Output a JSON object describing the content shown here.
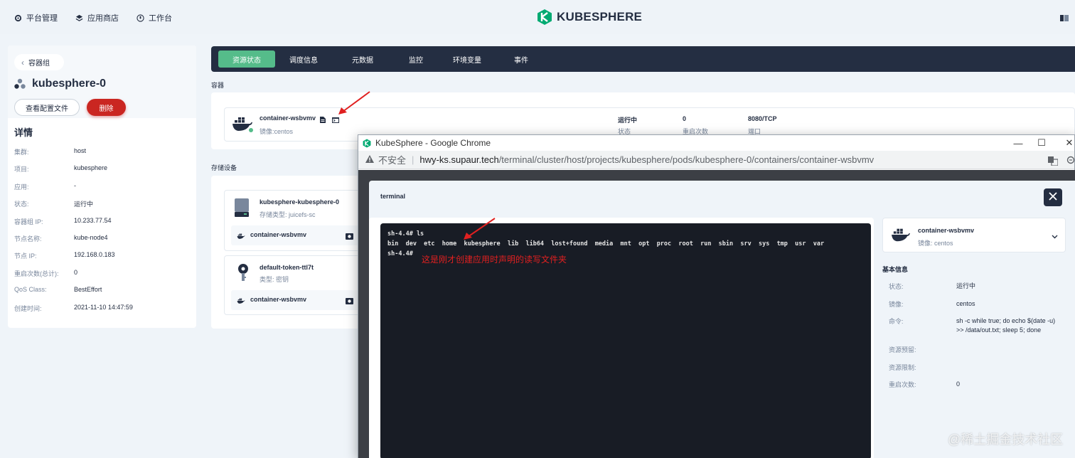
{
  "topnav": {
    "platform": "平台管理",
    "appstore": "应用商店",
    "workbench": "工作台",
    "brand": "KUBESPHERE"
  },
  "sidebar": {
    "back_label": "容器组",
    "pod_name": "kubesphere-0",
    "view_config_button": "查看配置文件",
    "delete_button": "删除",
    "details_title": "详情",
    "details": [
      {
        "key": "集群:",
        "value": "host"
      },
      {
        "key": "项目:",
        "value": "kubesphere"
      },
      {
        "key": "应用:",
        "value": "-"
      },
      {
        "key": "状态:",
        "value": "运行中"
      },
      {
        "key": "容器组 IP:",
        "value": "10.233.77.54"
      },
      {
        "key": "节点名称:",
        "value": "kube-node4"
      },
      {
        "key": "节点 IP:",
        "value": "192.168.0.183"
      },
      {
        "key": "重启次数(总计):",
        "value": "0"
      },
      {
        "key": "QoS Class:",
        "value": "BestEffort"
      },
      {
        "key": "创建时间:",
        "value": "2021-11-10 14:47:59"
      }
    ]
  },
  "tabs": [
    "资源状态",
    "调度信息",
    "元数据",
    "监控",
    "环境变量",
    "事件"
  ],
  "containers_section": {
    "label": "容器",
    "container": {
      "name": "container-wsbvmv",
      "image": "镜像:centos",
      "status_value": "运行中",
      "status_label": "状态",
      "restarts_value": "0",
      "restarts_label": "重启次数",
      "port_value": "8080/TCP",
      "port_label": "端口"
    }
  },
  "storage_section": {
    "label": "存储设备",
    "volumes": [
      {
        "name": "kubesphere-kubesphere-0",
        "type": "存储类型: juicefs-sc",
        "mount": "container-wsbvmv"
      },
      {
        "name": "default-token-ttl7t",
        "type": "类型: 密钥",
        "mount": "container-wsbvmv"
      }
    ]
  },
  "browser": {
    "title": "KubeSphere - Google Chrome",
    "insecure": "不安全",
    "url_host": "hwy-ks.supaur.tech",
    "url_path": "/terminal/cluster/host/projects/kubesphere/pods/kubesphere-0/containers/container-wsbvmv"
  },
  "terminal_modal": {
    "title": "terminal",
    "lines": [
      "sh-4.4# ls",
      "bin  dev  etc  home  kubesphere  lib  lib64  lost+found  media  mnt  opt  proc  root  run  sbin  srv  sys  tmp  usr  var",
      "sh-4.4#"
    ],
    "annotation": "这是刚才创建应用时声明的读写文件夹",
    "container_name": "container-wsbvmv",
    "container_image": "镜像: centos",
    "basic_info_title": "基本信息",
    "basic_info": [
      {
        "key": "状态:",
        "value": "运行中"
      },
      {
        "key": "镜像:",
        "value": "centos"
      },
      {
        "key": "命令:",
        "value": "sh -c while true; do echo $(date -u) >> /data/out.txt; sleep 5; done"
      },
      {
        "key": "资源预留:",
        "value": ""
      },
      {
        "key": "资源限制:",
        "value": ""
      },
      {
        "key": "重启次数:",
        "value": "0"
      }
    ]
  },
  "watermark": "@稀土掘金技术社区",
  "colors": {
    "accent": "#55bc8a",
    "dark": "#242e42",
    "danger": "#ca2621",
    "annotation": "#e02020"
  }
}
